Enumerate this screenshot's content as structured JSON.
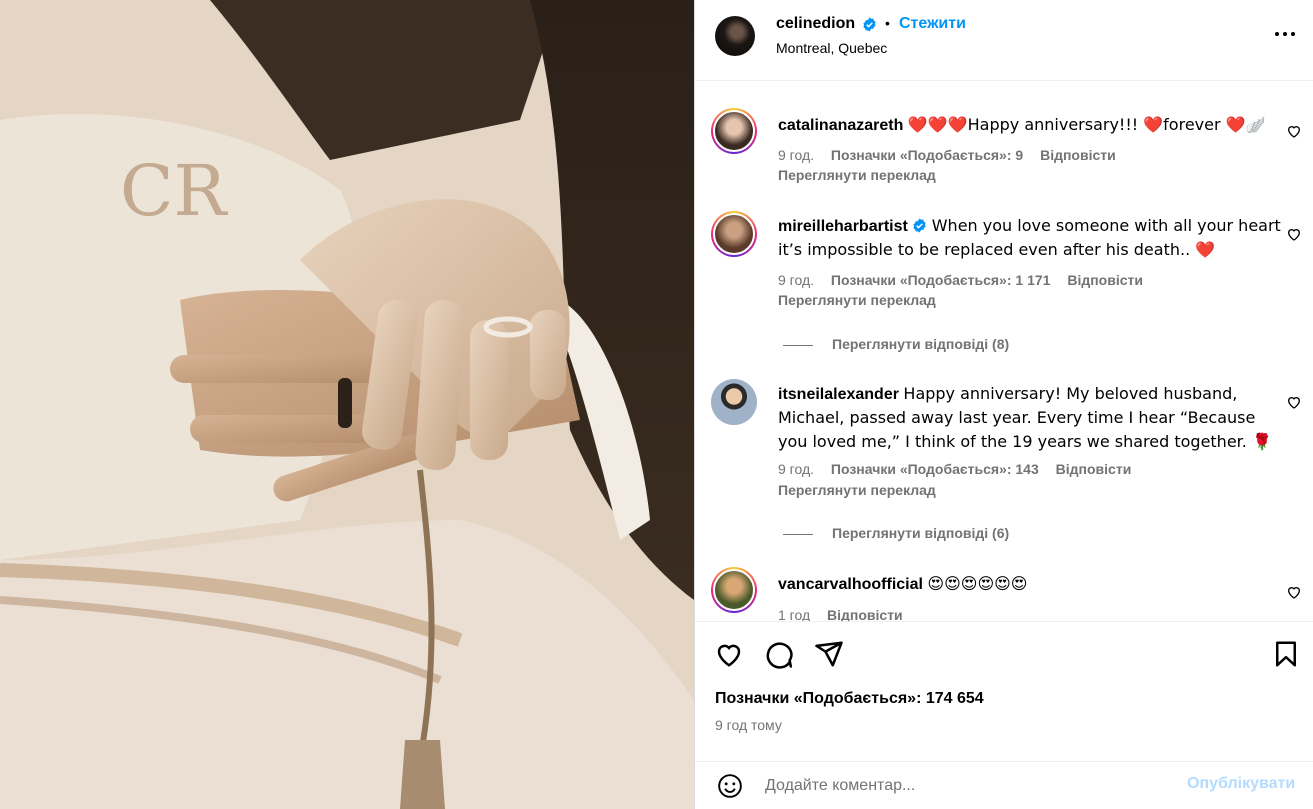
{
  "post": {
    "username": "celinedion",
    "follow_label": "Стежити",
    "location": "Montreal, Quebec",
    "separator": "•"
  },
  "comments": [
    {
      "username": "catalinanazareth",
      "text": "❤️❤️❤️Happy anniversary!!! ❤️forever ❤️🪽",
      "time": "9 год.",
      "likes": "Позначки «Подобається»: 9",
      "reply": "Відповісти",
      "translate": "Переглянути переклад"
    },
    {
      "username": "mireilleharbartist",
      "text": "When you love someone with all your heart it’s impossible to be replaced even after his death.. ❤️",
      "time": "9 год.",
      "likes": "Позначки «Подобається»: 1 171",
      "reply": "Відповісти",
      "translate": "Переглянути переклад",
      "view_replies": "Переглянути відповіді (8)"
    },
    {
      "username": "itsneilalexander",
      "text": "Happy anniversary! My beloved husband, Michael, passed away last year. Every time I hear “Because you loved me,” I think of the 19 years we shared together. 🌹",
      "time": "9 год.",
      "likes": "Позначки «Подобається»: 143",
      "reply": "Відповісти",
      "translate": "Переглянути переклад",
      "view_replies": "Переглянути відповіді (6)"
    },
    {
      "username": "vancarvalhoofficial",
      "text": "😍😍😍😍😍😍",
      "time": "1 год",
      "reply": "Відповісти"
    }
  ],
  "footer": {
    "likes": "Позначки «Подобається»: 174 654",
    "time_ago": "9 год тому",
    "comment_placeholder": "Додайте коментар...",
    "post_label": "Опублікувати"
  },
  "colors": {
    "link_blue": "#0095f6",
    "muted": "#737373",
    "post_disabled": "#b3dbff",
    "photo_sepia": "#d8c3ad"
  }
}
